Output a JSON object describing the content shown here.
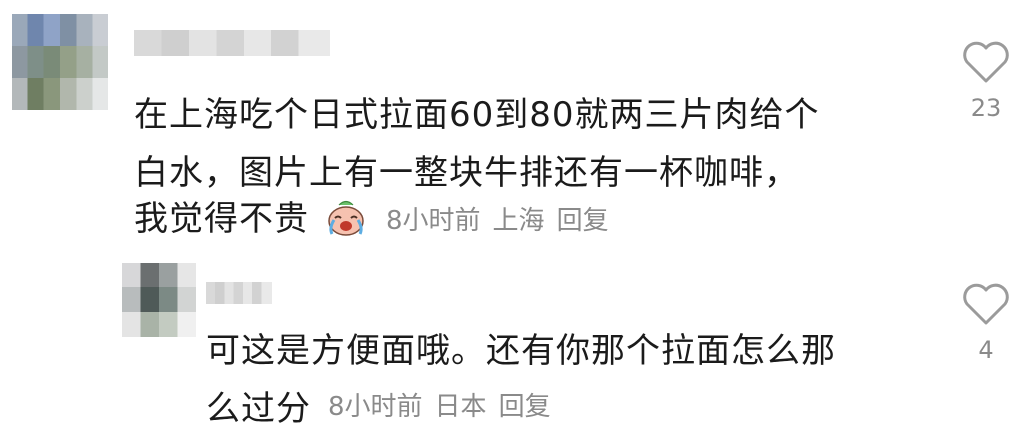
{
  "comments": [
    {
      "text_lines": [
        "在上海吃个日式拉面60到80就两三片肉给个",
        "白水，图片上有一整块牛排还有一杯咖啡，",
        "我觉得不贵"
      ],
      "emoji": "crying-laughing-emoji",
      "time": "8小时前",
      "location": "上海",
      "reply_label": "回复",
      "like_count": "23"
    },
    {
      "text_lines": [
        "可这是方便面哦。还有你那个拉面怎么那",
        "么过分"
      ],
      "time": "8小时前",
      "location": "日本",
      "reply_label": "回复",
      "like_count": "4"
    }
  ],
  "colors": {
    "text": "#1b1b1b",
    "meta": "#8a8a8a",
    "icon": "#9b9b9b"
  }
}
